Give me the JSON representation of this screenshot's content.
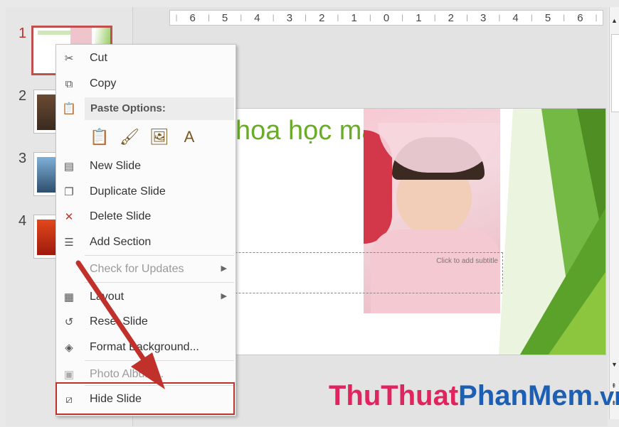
{
  "thumbnails": [
    {
      "num": "1",
      "selected": true
    },
    {
      "num": "2",
      "selected": false
    },
    {
      "num": "3",
      "selected": false
    },
    {
      "num": "4",
      "selected": false
    }
  ],
  "ruler": [
    "6",
    "5",
    "4",
    "3",
    "2",
    "1",
    "0",
    "1",
    "2",
    "3",
    "4",
    "5",
    "6"
  ],
  "slide": {
    "title": "hoa học máy tính",
    "subtitle_placeholder": "Click to add subtitle"
  },
  "menu": {
    "cut": "Cut",
    "copy": "Copy",
    "paste_options": "Paste Options:",
    "new_slide": "New Slide",
    "duplicate_slide": "Duplicate Slide",
    "delete_slide": "Delete Slide",
    "add_section": "Add Section",
    "check_updates": "Check for Updates",
    "layout": "Layout",
    "reset_slide": "Reset Slide",
    "format_background": "Format Background...",
    "photo_album": "Photo Album...",
    "hide_slide": "Hide Slide"
  },
  "watermark": {
    "part1": "ThuThuat",
    "part2": "PhanMem",
    "part3": ".vn"
  },
  "colors": {
    "accent_red": "#c0312b",
    "title_green": "#6aac2a",
    "watermark_pink": "#e0245e",
    "watermark_blue": "#1c5fb3"
  }
}
